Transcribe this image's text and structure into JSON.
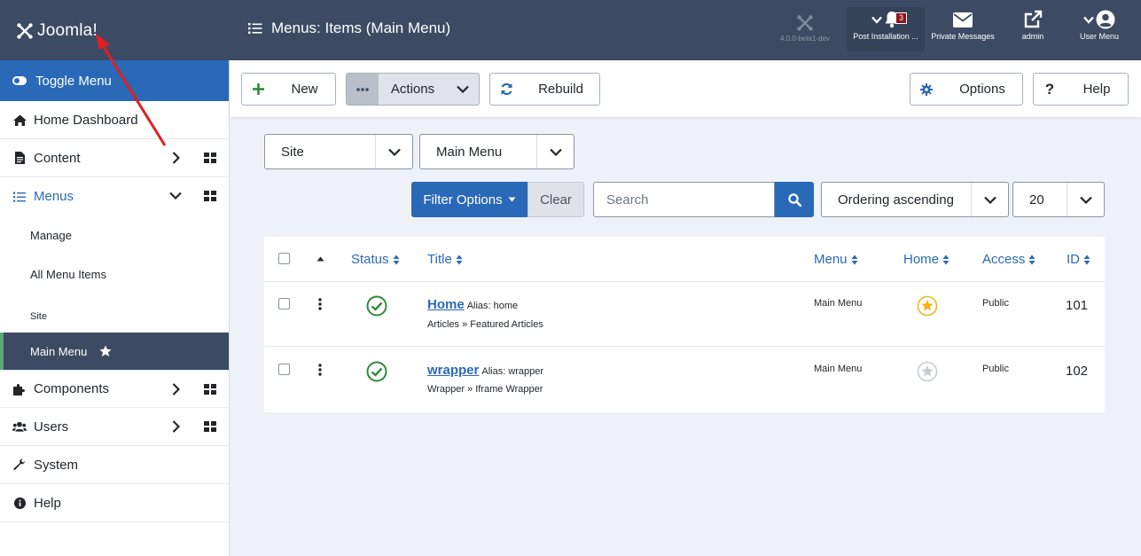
{
  "header": {
    "logo_text": "Joomla!",
    "page_title": "Menus: Items (Main Menu)",
    "version": "4.0.0-beta1-dev",
    "post_installation": {
      "label": "Post Installation ...",
      "count": "3"
    },
    "private_messages": "Private Messages",
    "admin": "admin",
    "user_menu": "User Menu"
  },
  "sidebar": {
    "toggle": "Toggle Menu",
    "home": "Home Dashboard",
    "content": "Content",
    "menus": "Menus",
    "menus_sub": {
      "manage": "Manage",
      "all_items": "All Menu Items",
      "site": "Site",
      "main_menu": "Main Menu"
    },
    "components": "Components",
    "users": "Users",
    "system": "System",
    "help": "Help"
  },
  "toolbar": {
    "new": "New",
    "actions": "Actions",
    "rebuild": "Rebuild",
    "options": "Options",
    "help": "Help"
  },
  "filters": {
    "client": "Site",
    "menu": "Main Menu",
    "filter_options": "Filter Options",
    "clear": "Clear",
    "search_placeholder": "Search",
    "ordering": "Ordering ascending",
    "limit": "20"
  },
  "table": {
    "headers": {
      "status": "Status",
      "title": "Title",
      "menu": "Menu",
      "home": "Home",
      "access": "Access",
      "id": "ID"
    },
    "rows": [
      {
        "title": "Home",
        "alias": "Alias: home",
        "type": "Articles » Featured Articles",
        "menu": "Main Menu",
        "home": true,
        "access": "Public",
        "id": "101"
      },
      {
        "title": "wrapper",
        "alias": "Alias: wrapper",
        "type": "Wrapper » Iframe Wrapper",
        "menu": "Main Menu",
        "home": false,
        "access": "Public",
        "id": "102"
      }
    ]
  },
  "colors": {
    "header": "#3c4b63",
    "accent": "#2a69b8",
    "published": "#2f8a3a",
    "home_star": "#f0b61a"
  }
}
